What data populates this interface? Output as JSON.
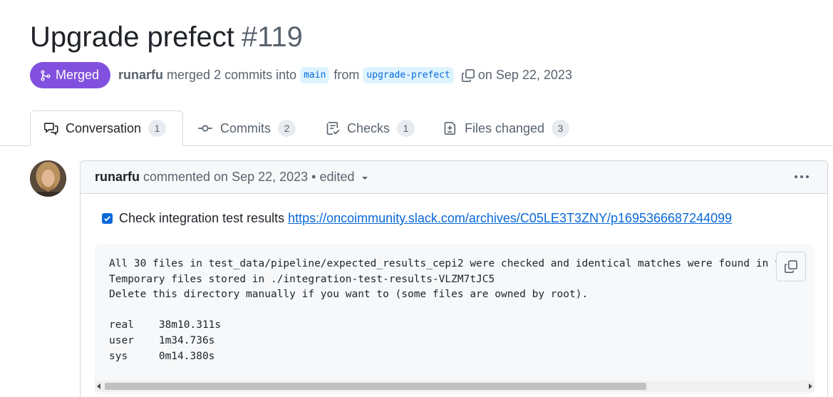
{
  "pr": {
    "title": "Upgrade prefect",
    "number": "#119",
    "state": "Merged",
    "author": "runarfu",
    "merged_text": "merged 2 commits into",
    "base_branch": "main",
    "from_text": "from",
    "head_branch": "upgrade-prefect",
    "date_text": "on Sep 22, 2023"
  },
  "tabs": [
    {
      "label": "Conversation",
      "count": "1",
      "icon": "comment-discussion-icon"
    },
    {
      "label": "Commits",
      "count": "2",
      "icon": "git-commit-icon"
    },
    {
      "label": "Checks",
      "count": "1",
      "icon": "checklist-icon"
    },
    {
      "label": "Files changed",
      "count": "3",
      "icon": "file-diff-icon"
    }
  ],
  "comment": {
    "author": "runarfu",
    "meta": "commented on Sep 22, 2023 • edited",
    "task_label": "Check integration test results",
    "task_checked": true,
    "task_link": "https://oncoimmunity.slack.com/archives/C05LE3T3ZNY/p1695366687244099",
    "code": "All 30 files in test_data/pipeline/expected_results_cepi2 were checked and identical matches were found in the\nTemporary files stored in ./integration-test-results-VLZM7tJC5\nDelete this directory manually if you want to (some files are owned by root).\n\nreal\t38m10.311s\nuser\t1m34.736s\nsys\t0m14.380s"
  },
  "colors": {
    "merged": "#8250df",
    "link": "#0969da",
    "branch_bg": "#ddf4ff"
  }
}
